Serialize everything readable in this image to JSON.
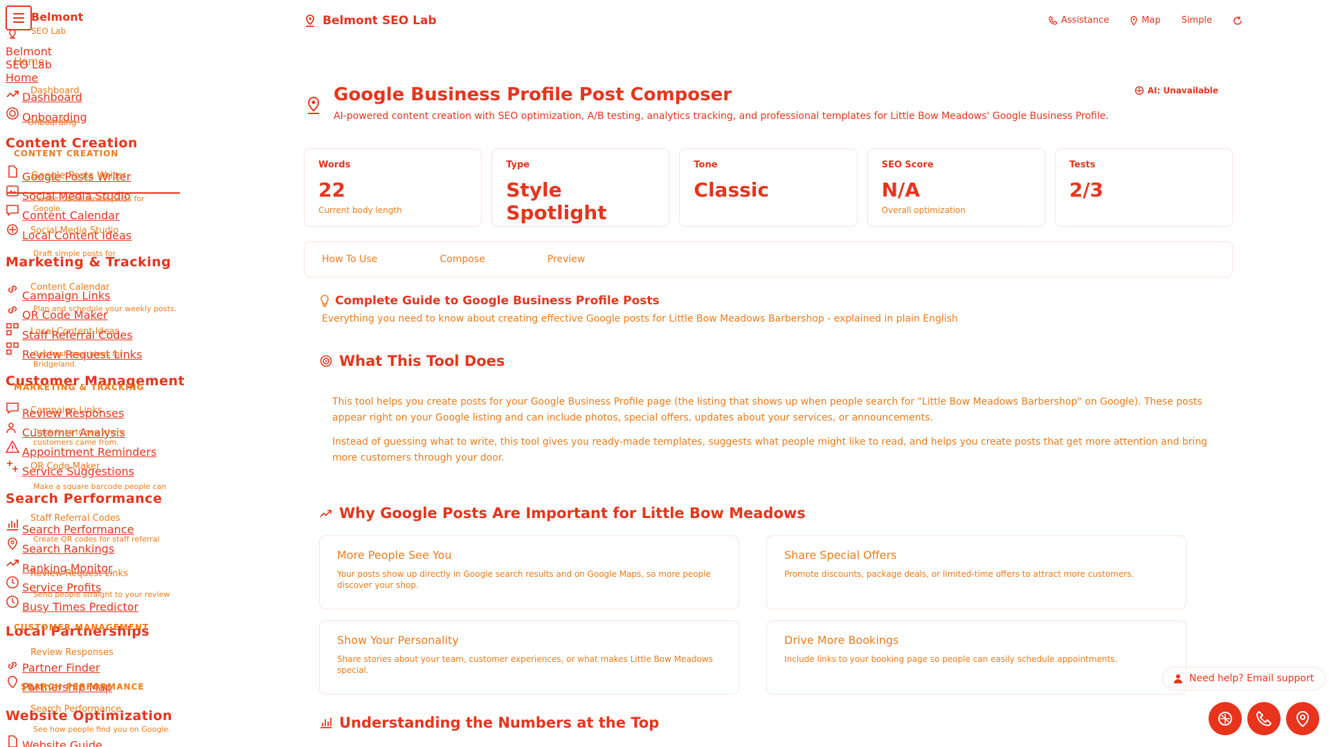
{
  "sidebar": {
    "brand_name": "Belmont",
    "brand_sub": "SEO Lab",
    "brand_line1": "Belmont",
    "brand_line2": "SEO Lab",
    "home_ghost": "Home",
    "home": "Home",
    "dashboard_ghost": "Dashboard",
    "dashboard": "Dashboard",
    "onboarding": "Onboarding",
    "onboarding_ghost": "Onboarding",
    "sections": {
      "content_creation": "Content Creation",
      "content_creation_small": "CONTENT CREATION",
      "marketing": "Marketing & Tracking",
      "marketing_small": "MARKETING & TRACKING",
      "customer": "Customer Management",
      "customer_small": "CUSTOMER MANAGEMENT",
      "search": "Search Performance",
      "search_small": "SEARCH PERFORMANCE",
      "local": "Local Partnerships",
      "website": "Website Optimization"
    },
    "links": {
      "google_posts_writer": "Google Posts Writer",
      "google_posts_writer_ghost": "Google Posts Writer",
      "social_media_studio": "Social Media Studio",
      "social_desc": "Create social media posts for",
      "social_desc2": "Google.",
      "content_calendar": "Content Calendar",
      "local_content_ideas": "Local Content Ideas",
      "social_ghost": "Social Media Studio",
      "draft_desc": "Draft simple posts for",
      "content_calendar_ghost": "Content Calendar",
      "campaign_links": "Campaign Links",
      "plan_desc": "Plan and schedule your weekly posts.",
      "qr_code_maker": "QR Code Maker",
      "local_ideas_ghost": "Local Content Ideas",
      "staff_referral_codes": "Staff Referral Codes",
      "review_request_links": "Review Request Links",
      "ideas_desc": "Get fresh post ideas for",
      "ideas_desc2": "Bridgeland.",
      "review_responses": "Review Responses",
      "campaign_ghost": "Campaign Links",
      "customer_analysis": "Customer Analysis",
      "track_desc": "Track links to see where",
      "track_desc2": "customers came from.",
      "appointment_reminders": "Appointment Reminders",
      "qr_ghost": "QR Code Maker",
      "service_suggestions": "Service Suggestions",
      "qr_desc": "Make a square barcode people can",
      "staff_ghost": "Staff Referral Codes",
      "staff_desc": "Create QR codes for staff referral",
      "search_performance": "Search Performance",
      "search_rankings": "Search Rankings",
      "review_links_ghost": "Review Request Links",
      "ranking_monitor": "Ranking Monitor",
      "service_profits": "Service Profits",
      "send_desc": "Send people straight to your review",
      "busy_times_predictor": "Busy Times Predictor",
      "review_resp_ghost": "Review Responses",
      "partner_finder": "Partner Finder",
      "partnership_map": "Partnership Map",
      "search_perf_ghost": "Search Performance",
      "see_desc": "See how people find you on Google.",
      "website_guide": "Website Guide"
    }
  },
  "topbar": {
    "title": "Belmont SEO Lab",
    "assistance": "Assistance",
    "map": "Map",
    "simple": "Simple"
  },
  "header": {
    "title": "Google Business Profile Post Composer",
    "subtitle": "AI-powered content creation with SEO optimization, A/B testing, analytics tracking, and professional templates for Little Bow Meadows' Google Business Profile.",
    "ai_status": "AI: Unavailable"
  },
  "stats": [
    {
      "label": "Words",
      "value": "22",
      "note": "Current body length"
    },
    {
      "label": "Type",
      "value": "Style Spotlight",
      "note": ""
    },
    {
      "label": "Tone",
      "value": "Classic",
      "note": ""
    },
    {
      "label": "SEO Score",
      "value": "N/A",
      "note": "Overall optimization"
    },
    {
      "label": "Tests",
      "value": "2/3",
      "note": ""
    }
  ],
  "tabs": [
    "How To Use",
    "Compose",
    "Preview"
  ],
  "guide": {
    "title": "Complete Guide to Google Business Profile Posts",
    "subtitle": "Everything you need to know about creating effective Google posts for Little Bow Meadows Barbershop - explained in plain English",
    "what_title": "What This Tool Does",
    "what_p1": "This tool helps you create posts for your Google Business Profile page (the listing that shows up when people search for \"Little Bow Meadows Barbershop\" on Google). These posts appear right on your Google listing and can include photos, special offers, updates about your services, or announcements.",
    "what_p2": "Instead of guessing what to write, this tool gives you ready-made templates, suggests what people might like to read, and helps you create posts that get more attention and bring more customers through your door.",
    "why_title": "Why Google Posts Are Important for Little Bow Meadows",
    "cards": [
      {
        "title": "More People See You",
        "text": "Your posts show up directly in Google search results and on Google Maps, so more people discover your shop."
      },
      {
        "title": "Share Special Offers",
        "text": "Promote discounts, package deals, or limited-time offers to attract more customers."
      },
      {
        "title": "Show Your Personality",
        "text": "Share stories about your team, customer experiences, or what makes Little Bow Meadows special."
      },
      {
        "title": "Drive More Bookings",
        "text": "Include links to your booking page so people can easily schedule appointments."
      }
    ],
    "numbers_title": "Understanding the Numbers at the Top"
  },
  "help": {
    "label": "Need help? Email support"
  },
  "colors": {
    "primary": "#e8341c",
    "secondary": "#f07a1a"
  }
}
